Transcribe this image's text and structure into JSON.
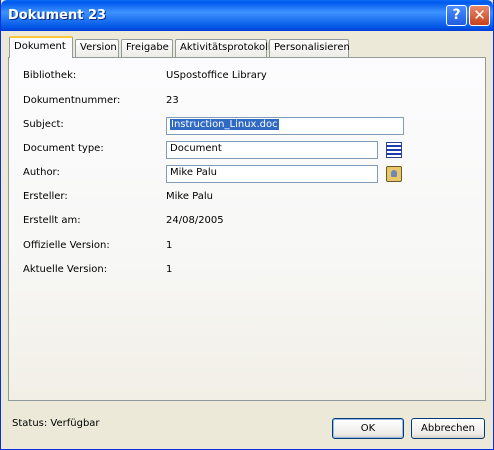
{
  "window": {
    "title": "Dokument 23"
  },
  "titlebar_buttons": {
    "help": "?",
    "close": "✕"
  },
  "tabs": [
    {
      "label": "Dokument",
      "active": true
    },
    {
      "label": "Version"
    },
    {
      "label": "Freigabe"
    },
    {
      "label": "Aktivitätsprotokoll"
    },
    {
      "label": "Personalisieren"
    }
  ],
  "fields": {
    "bibliothek": {
      "label": "Bibliothek:",
      "value": "USpostoffice Library"
    },
    "dokumentnummer": {
      "label": "Dokumentnummer:",
      "value": "23"
    },
    "subject": {
      "label": "Subject:",
      "value": "Instruction_Linux.doc"
    },
    "document_type": {
      "label": "Document type:",
      "value": "Document"
    },
    "author": {
      "label": "Author:",
      "value": "Mike Palu"
    },
    "ersteller": {
      "label": "Ersteller:",
      "value": "Mike Palu"
    },
    "erstellt_am": {
      "label": "Erstellt am:",
      "value": "24/08/2005"
    },
    "offizielle_version": {
      "label": "Offizielle Version:",
      "value": "1"
    },
    "aktuelle_version": {
      "label": "Aktuelle Version:",
      "value": "1"
    }
  },
  "icons": {
    "document_type_picker": "list-icon",
    "author_picker": "person-icon"
  },
  "status": {
    "text": "Status: Verfügbar"
  },
  "buttons": {
    "ok": "OK",
    "cancel": "Abbrechen"
  }
}
